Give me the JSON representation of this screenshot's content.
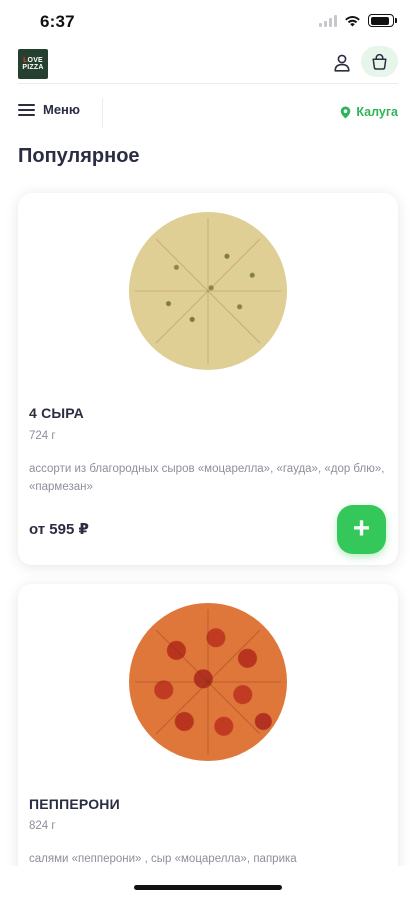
{
  "status_bar": {
    "time": "6:37",
    "battery_level": 0.9,
    "icons": [
      "signal-icon",
      "wifi-icon",
      "battery-icon"
    ]
  },
  "header": {
    "logo_text_top": "LOVE",
    "logo_text_bottom": "PIZZA",
    "logo_bg_color": "#25402e",
    "profile_icon": "user-icon",
    "cart_icon": "basket-icon"
  },
  "menu_bar": {
    "menu_label": "Меню",
    "city_label": "Калуга",
    "city_icon": "location-pin-icon",
    "accent_color": "#2fb457"
  },
  "section": {
    "title": "Популярное"
  },
  "products": [
    {
      "name": "4 СЫРА",
      "weight": "724 г",
      "description": "ассорти из благородных сыров «моцарелла», «гауда», «дор блю», «пармезан»",
      "price": "от 595 ₽",
      "add_label": "+"
    },
    {
      "name": "ПЕППЕРОНИ",
      "weight": "824 г",
      "description": "салями «пепперони» , сыр «моцарелла», паприка"
    }
  ],
  "colors": {
    "add_button": "#34c759",
    "text_primary": "#2b2d42",
    "text_secondary": "#8c8f9c"
  }
}
